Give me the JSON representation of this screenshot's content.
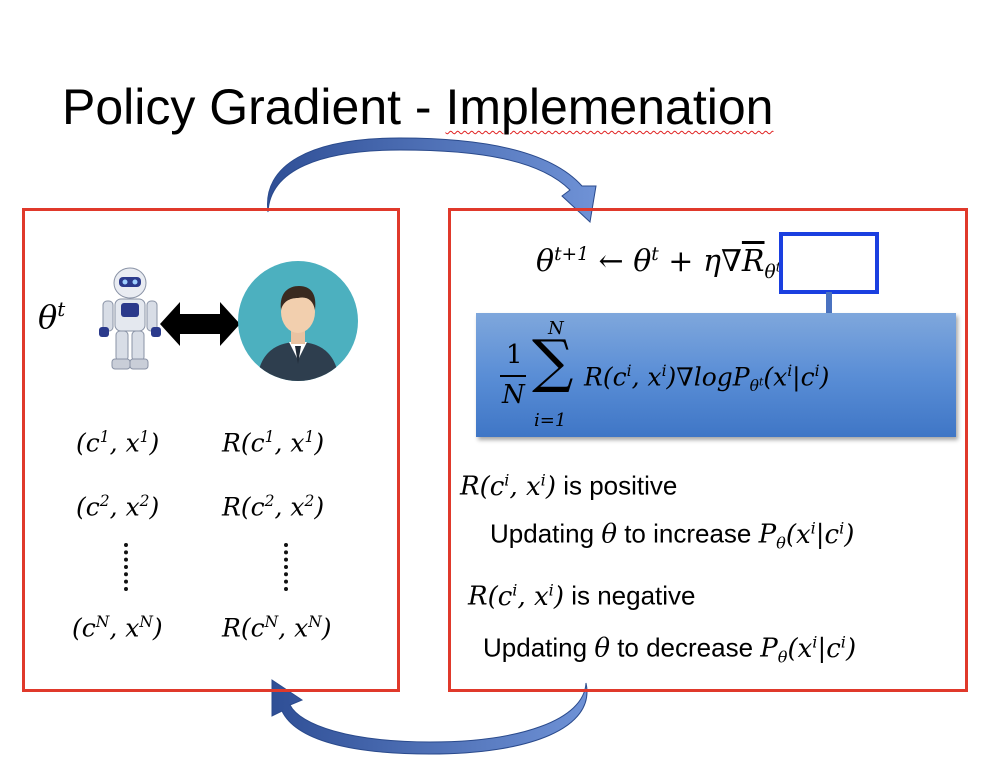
{
  "title": {
    "text": "Policy Gradient - ",
    "misspelled": "Implemenation"
  },
  "left_panel": {
    "theta_label": "θ",
    "theta_sup": "t",
    "pairs": [
      {
        "c": "c",
        "x": "x",
        "sup": "1"
      },
      {
        "c": "c",
        "x": "x",
        "sup": "2"
      },
      {
        "c": "c",
        "x": "x",
        "sup": "N"
      }
    ],
    "reward_fn": "R"
  },
  "right_panel": {
    "update_rule": {
      "lhs": "θ",
      "lhs_sup": "t+1",
      "arrow": "←",
      "rhs": "θ",
      "rhs_sup": "t",
      "plus": "+",
      "eta": "η",
      "grad": "∇",
      "R": "R",
      "sub": "θ",
      "subsup": "t"
    },
    "gradient_estimate": {
      "frac_num": "1",
      "frac_den": "N",
      "sum_top": "N",
      "sum_bottom": "i=1",
      "body": "R",
      "grad_log": "∇logP",
      "sub": "θ",
      "subsup": "t"
    },
    "positive": {
      "prefix": "R",
      "suffix": " is positive",
      "update": "Updating ",
      "theta": "θ",
      "action": " to increase ",
      "P": "P",
      "Psub": "θ"
    },
    "negative": {
      "prefix": "R",
      "suffix": " is negative",
      "update": "Updating ",
      "theta": "θ",
      "action": " to decrease ",
      "P": "P",
      "Psub": "θ"
    }
  },
  "colors": {
    "frame": "#e0392b",
    "highlight": "#1a3fe0",
    "arrow": "#3c5fa8",
    "sumbox": "#5a8ed6"
  }
}
